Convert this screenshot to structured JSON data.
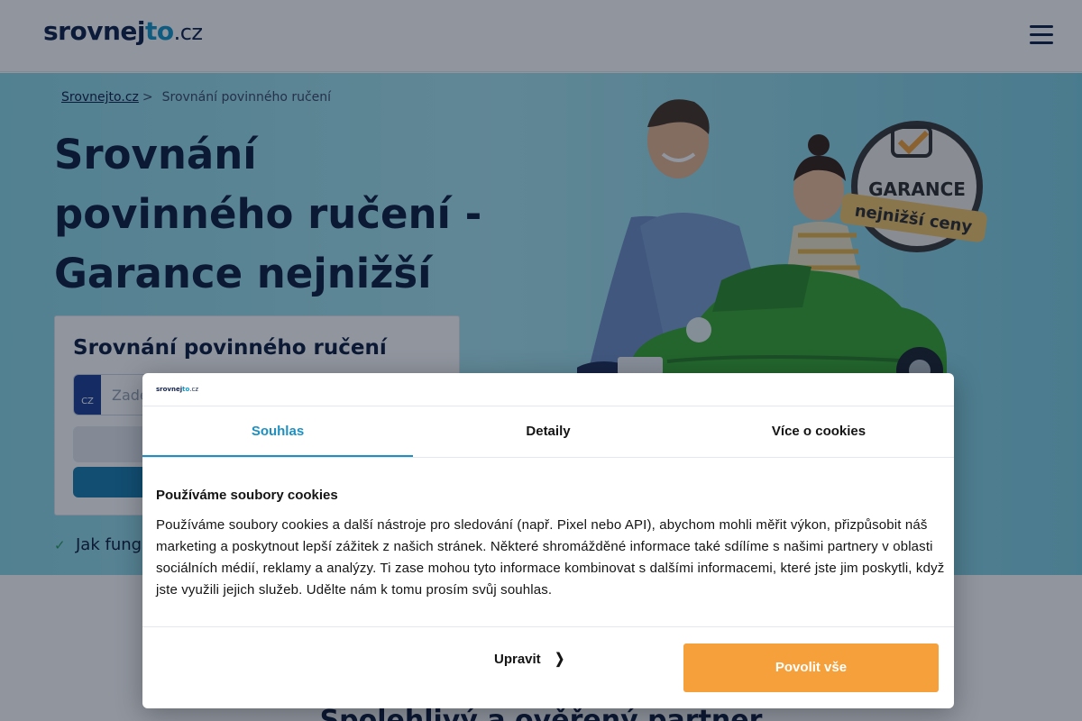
{
  "header": {
    "logo": {
      "part1": "srovnej",
      "part2": "to",
      "part3": ".cz"
    },
    "menu_icon": "hamburger-icon"
  },
  "breadcrumb": {
    "home": "Srovnejto.cz",
    "separator": ">",
    "current": "Srovnání povinného ručení"
  },
  "hero": {
    "title": "Srovnání povinného ručení - Garance nejnižší ceny",
    "badge_line1": "GARANCE",
    "badge_line2": "nejnižší ceny"
  },
  "form": {
    "heading": "Srovnání povinného ručení",
    "plate_country": "CZ",
    "plate_placeholder": "Zadejte SPZ"
  },
  "how_it_works": "Jak funguje srovnání",
  "lower_section_title": "Spolehlivý a ověřený partner",
  "cookie_dialog": {
    "logo": {
      "part1": "srovnej",
      "part2": "to",
      "part3": ".cz"
    },
    "tabs": [
      {
        "label": "Souhlas",
        "active": true
      },
      {
        "label": "Detaily",
        "active": false
      },
      {
        "label": "Více o cookies",
        "active": false
      }
    ],
    "heading": "Používáme soubory cookies",
    "text": "Používáme soubory cookies a další nástroje pro sledování (např. Pixel nebo API), abychom mohli měřit výkon, přizpůsobit náš marketing a poskytnout lepší zážitek z našich stránek. Některé shromážděné informace také sdílíme s našimi partnery v oblasti sociálních médií, reklamy a analýzy. Ti zase mohou tyto informace kombinovat s dalšími informacemi, které jste jim poskytli, když jste využili jejich služeb. Udělte nám k tomu prosím svůj souhlas.",
    "edit_button": "Upravit",
    "allow_all_button": "Povolit vše"
  },
  "colors": {
    "brand_dark": "#12224a",
    "brand_blue": "#1597c9",
    "accent_orange": "#f5a03a",
    "tab_active": "#1e8fc0"
  }
}
